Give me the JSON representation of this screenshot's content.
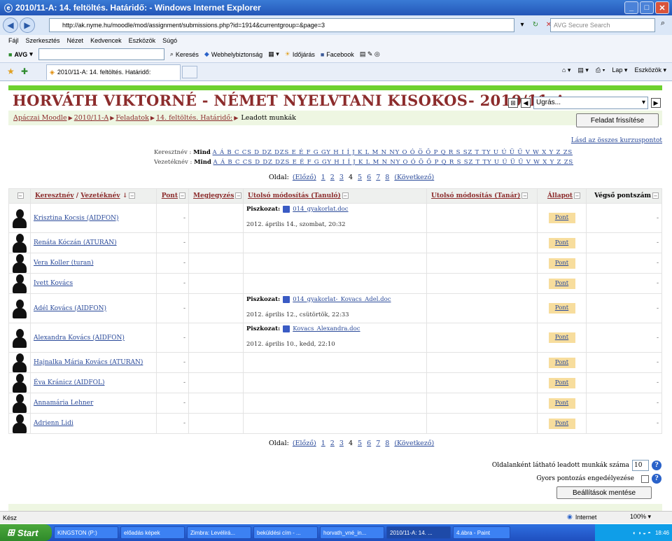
{
  "browser": {
    "window_title": "2010/11-A: 14. feltöltés. Határidő: - Windows Internet Explorer",
    "url": "http://ak.nyme.hu/moodle/mod/assignment/submissions.php?id=1914&currentgroup=&page=3",
    "search_placeholder": "AVG Secure Search",
    "menu": [
      "Fájl",
      "Szerkesztés",
      "Nézet",
      "Kedvencek",
      "Eszközök",
      "Súgó"
    ],
    "toolbar": {
      "avg_label": "AVG",
      "search_label": "Keresés",
      "safety_label": "Webhelybiztonság",
      "weather_label": "Időjárás",
      "facebook_label": "Facebook"
    },
    "tab_title": "2010/11-A: 14. feltöltés. Határidő:",
    "tab_tools": {
      "page_label": "Lap",
      "tools_label": "Eszközök"
    }
  },
  "course": {
    "title": "HORVÁTH VIKTORNÉ - NÉMET NYELVTANI KISOKOS- 2010/11-A",
    "jump_select": "Ugrás...",
    "breadcrumb": [
      "Apáczai Moodle",
      "2010/11-A",
      "Feladatok",
      "14. feltöltés. Határidő:"
    ],
    "breadcrumb_current": "Leadott munkák",
    "refresh_button": "Feladat frissítése",
    "all_groups_link": "Lásd az összes kurzuspontot"
  },
  "initials": {
    "first_label": "Keresztnév :",
    "last_label": "Vezetéknév :",
    "all": "Mind",
    "letters": "A Á B C CS D DZ DZS E É F G GY H I Í J K L M N NY O Ó Ö Ő P Q R S SZ T TY U Ú Ü Ű V W X Y Z ZS"
  },
  "paging": {
    "label": "Oldal:",
    "prev": "(Előző)",
    "pages": [
      "1",
      "2",
      "3",
      "4",
      "5",
      "6",
      "7",
      "8"
    ],
    "current": "4",
    "next": "(Következő)"
  },
  "table": {
    "headers": {
      "firstname": "Keresztnév",
      "lastname": "Vezetéknév",
      "grade": "Pont",
      "comment": "Megjegyzés",
      "student_modified": "Utolsó módosítás (Tanuló)",
      "teacher_modified": "Utolsó módosítás (Tanár)",
      "status": "Állapot",
      "final_grade": "Végső pontszám"
    },
    "rows": [
      {
        "name": "Krisztina Kocsis (AIDFON)",
        "grade": "-",
        "draft_label": "Piszkozat:",
        "file": "014_gyakorlat.doc",
        "date": "2012. április 14., szombat, 20:32",
        "status": "Pont",
        "final": "-"
      },
      {
        "name": "Renáta Kóczán (ATURAN)",
        "grade": "-",
        "draft_label": "",
        "file": "",
        "date": "",
        "status": "Pont",
        "final": "-"
      },
      {
        "name": "Vera Koller (turan)",
        "grade": "-",
        "draft_label": "",
        "file": "",
        "date": "",
        "status": "Pont",
        "final": "-"
      },
      {
        "name": "Ivett Kovács",
        "grade": "-",
        "draft_label": "",
        "file": "",
        "date": "",
        "status": "Pont",
        "final": "-"
      },
      {
        "name": "Adél Kovács (AIDFON)",
        "grade": "-",
        "draft_label": "Piszkozat:",
        "file": "014_gyakorlat-_Kovacs_Adel.doc",
        "date": "2012. április 12., csütörtök, 22:33",
        "status": "Pont",
        "final": "-"
      },
      {
        "name": "Alexandra Kovács (AIDFON)",
        "grade": "-",
        "draft_label": "Piszkozat:",
        "file": "Kovacs_Alexandra.doc",
        "date": "2012. április 10., kedd, 22:10",
        "status": "Pont",
        "final": "-"
      },
      {
        "name": "Hajnalka Mária Kovács (ATURAN)",
        "grade": "-",
        "draft_label": "",
        "file": "",
        "date": "",
        "status": "Pont",
        "final": "-"
      },
      {
        "name": "Éva Kránicz (AIDFOL)",
        "grade": "-",
        "draft_label": "",
        "file": "",
        "date": "",
        "status": "Pont",
        "final": "-"
      },
      {
        "name": "Annamária Lehner",
        "grade": "-",
        "draft_label": "",
        "file": "",
        "date": "",
        "status": "Pont",
        "final": "-"
      },
      {
        "name": "Adrienn Lidi",
        "grade": "-",
        "draft_label": "",
        "file": "",
        "date": "",
        "status": "Pont",
        "final": "-"
      }
    ]
  },
  "settings": {
    "per_page_label": "Oldalanként látható leadott munkák száma",
    "per_page_value": "10",
    "quick_grading_label": "Gyors pontozás engedélyezése",
    "save_button": "Beállítások mentése"
  },
  "statusbar": {
    "left": "Kész",
    "zone": "Internet",
    "zoom": "100%"
  },
  "taskbar": {
    "start": "Start",
    "tasks": [
      "KINGSTON (P:)",
      "előadás képek",
      "Zimbra: Levélirá...",
      "beküldési cím - ...",
      "horvath_vné_in...",
      "2010/11-A: 14. ...",
      "4.ábra - Paint"
    ],
    "active_task_index": 5,
    "clock": "18:46"
  },
  "colors": {
    "course_title": "#8c2c2c",
    "green_bar": "#6dd12f",
    "grade_button": "#f7dd9d",
    "link": "#2a4a9a"
  }
}
